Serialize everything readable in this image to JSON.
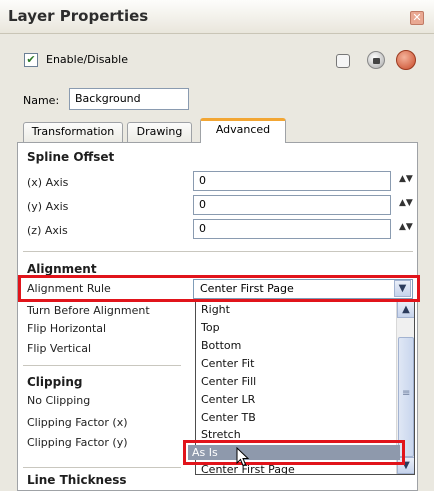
{
  "window": {
    "title": "Layer Properties",
    "close_glyph": "✕"
  },
  "enable": {
    "checked_glyph": "✔",
    "label": "Enable/Disable"
  },
  "name": {
    "label": "Name:",
    "value": "Background"
  },
  "tabs": [
    {
      "label": "Transformation"
    },
    {
      "label": "Drawing"
    },
    {
      "label": "Advanced",
      "active": true
    }
  ],
  "spline_offset": {
    "title": "Spline Offset",
    "axes": [
      {
        "label": "(x) Axis",
        "value": "0"
      },
      {
        "label": "(y) Axis",
        "value": "0"
      },
      {
        "label": "(z) Axis",
        "value": "0"
      }
    ],
    "spinner_glyph": "▲▼"
  },
  "alignment": {
    "title": "Alignment",
    "rule_label": "Alignment Rule",
    "rule_value": "Center First Page",
    "rows": [
      "Turn Before Alignment",
      "Flip Horizontal",
      "Flip Vertical"
    ],
    "dropdown_options": [
      "Right",
      "Top",
      "Bottom",
      "Center Fit",
      "Center Fill",
      "Center LR",
      "Center TB",
      "Stretch",
      "As Is",
      "Center First Page"
    ],
    "highlighted_option": "As Is",
    "arrow_down": "▼",
    "arrow_up": "▲"
  },
  "clipping": {
    "title": "Clipping",
    "rows": [
      "No Clipping",
      "Clipping Factor (x)",
      "Clipping Factor (y)"
    ]
  },
  "line_thickness": {
    "title": "Line Thickness"
  },
  "colors": {
    "highlight": "#e1141b",
    "tab_accent": "#f2a634",
    "selection": "#8e99ac"
  }
}
